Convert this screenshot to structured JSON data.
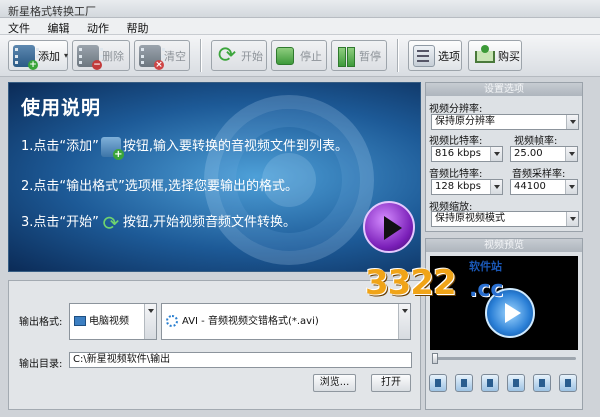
{
  "window": {
    "title": "新星格式转换工厂"
  },
  "menu": [
    "文件",
    "编辑",
    "动作",
    "帮助"
  ],
  "toolbar": {
    "add": "添加",
    "delete": "删除",
    "clear": "清空",
    "start": "开始",
    "stop": "停止",
    "pause": "暂停",
    "options": "选项",
    "buy": "购买"
  },
  "banner": {
    "title": "使用说明",
    "step1_a": "1.点击“添加”",
    "step1_b": "按钮,输入要转换的音视频文件到列表。",
    "step2": "2.点击“输出格式”选项框,选择您要输出的格式。",
    "step3_a": "3.点击“开始”",
    "step3_b": "按钮,开始视频音频文件转换。"
  },
  "settings": {
    "header": "设置选项",
    "video_resolution_label": "视频分辨率:",
    "video_resolution_value": "保持原分辨率",
    "video_bitrate_label": "视频比特率:",
    "video_bitrate_value": "816 kbps",
    "video_framerate_label": "视频帧率:",
    "video_framerate_value": "25.00",
    "audio_bitrate_label": "音频比特率:",
    "audio_bitrate_value": "128 kbps",
    "audio_samplerate_label": "音频采样率:",
    "audio_samplerate_value": "44100",
    "video_scale_label": "视频缩放:",
    "video_scale_value": "保持原视频模式"
  },
  "preview": {
    "header": "视频预览"
  },
  "output": {
    "format_label": "输出格式:",
    "device_value": "电脑视频",
    "format_value": "AVI - 音频视频交错格式(*.avi)",
    "dir_label": "输出目录:",
    "dir_value": "C:\\新星视频软件\\输出",
    "browse": "浏览...",
    "open": "打开"
  },
  "watermark": {
    "digits": "3322",
    "tld": ".cc",
    "tag": "软件站"
  },
  "colors": {
    "accent_blue": "#1d5a97",
    "play_purple": "#7a1fb8",
    "green": "#3e9a3b"
  }
}
